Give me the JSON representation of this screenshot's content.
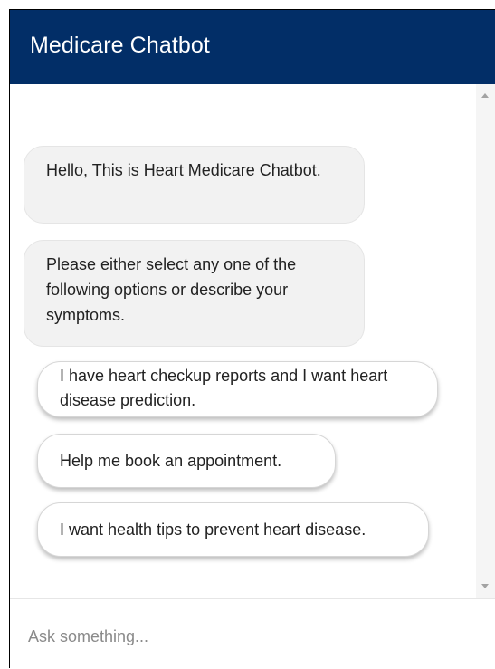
{
  "header": {
    "title": "Medicare Chatbot"
  },
  "messages": [
    {
      "text": "Hello, This is Heart Medicare Chatbot."
    },
    {
      "text": "Please either select any one of the following options or describe your symptoms."
    }
  ],
  "options": [
    {
      "label": "I have heart checkup reports and I want heart disease prediction."
    },
    {
      "label": "Help me book an appointment."
    },
    {
      "label": "I want health tips to prevent heart disease."
    }
  ],
  "input": {
    "value": "",
    "placeholder": "Ask something..."
  },
  "colors": {
    "header_bg": "#022e67",
    "bubble_bg": "#f2f2f2"
  },
  "icons": {
    "scroll_up": "triangle-up-icon",
    "scroll_down": "triangle-down-icon"
  }
}
